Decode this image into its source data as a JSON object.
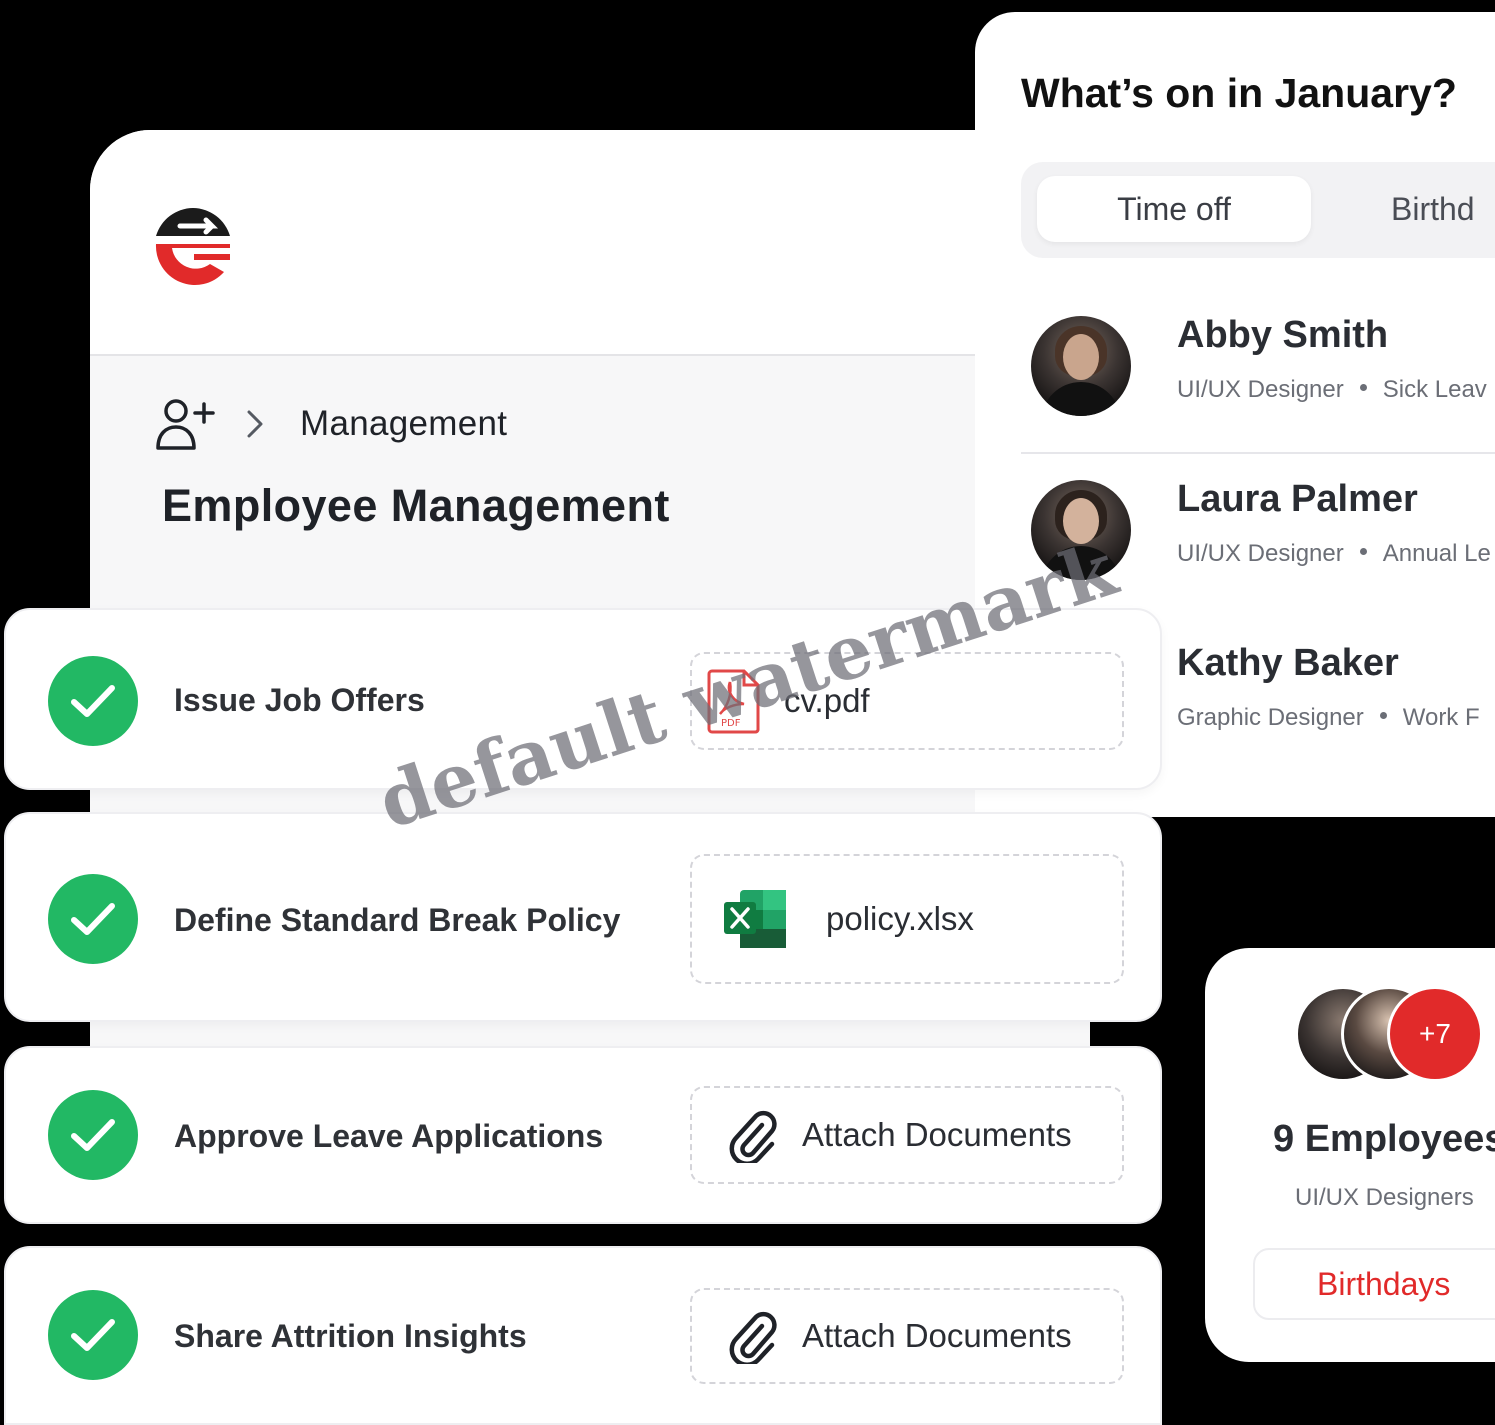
{
  "header": {
    "logo_icon": "company-logo-icon"
  },
  "breadcrumb": {
    "icon": "add-user-icon",
    "separator_icon": "chevron-right-icon",
    "current": "Management"
  },
  "page": {
    "title": "Employee Management"
  },
  "calendar": {
    "title": "What’s on in January?",
    "tabs": [
      {
        "label": "Time off",
        "active": true
      },
      {
        "label": "Birthd",
        "active": false
      }
    ],
    "people": [
      {
        "name": "Abby Smith",
        "role": "UI/UX Designer",
        "status": "Sick Leav"
      },
      {
        "name": "Laura Palmer",
        "role": "UI/UX Designer",
        "status": "Annual Le"
      },
      {
        "name": "Kathy Baker",
        "role": "Graphic Designer",
        "status": "Work F"
      }
    ]
  },
  "tasks": [
    {
      "label": "Issue Job Offers",
      "file": "cv.pdf",
      "file_icon": "pdf-file-icon",
      "done": true
    },
    {
      "label": "Define Standard Break Policy",
      "file": "policy.xlsx",
      "file_icon": "excel-file-icon",
      "done": true
    },
    {
      "label": "Approve Leave Applications",
      "file": "Attach Documents",
      "file_icon": "paperclip-icon",
      "done": true
    },
    {
      "label": "Share Attrition Insights",
      "file": "Attach Documents",
      "file_icon": "paperclip-icon",
      "done": true
    }
  ],
  "team": {
    "more_count": "+7",
    "count_label": "9 Employees",
    "role": "UI/UX Designers",
    "button_label": "Birthdays"
  },
  "watermark": "default watermark",
  "colors": {
    "accent_red": "#e12a2a",
    "success_green": "#22b864",
    "text_dark": "#2a2d33",
    "text_muted": "#6b6e76"
  }
}
